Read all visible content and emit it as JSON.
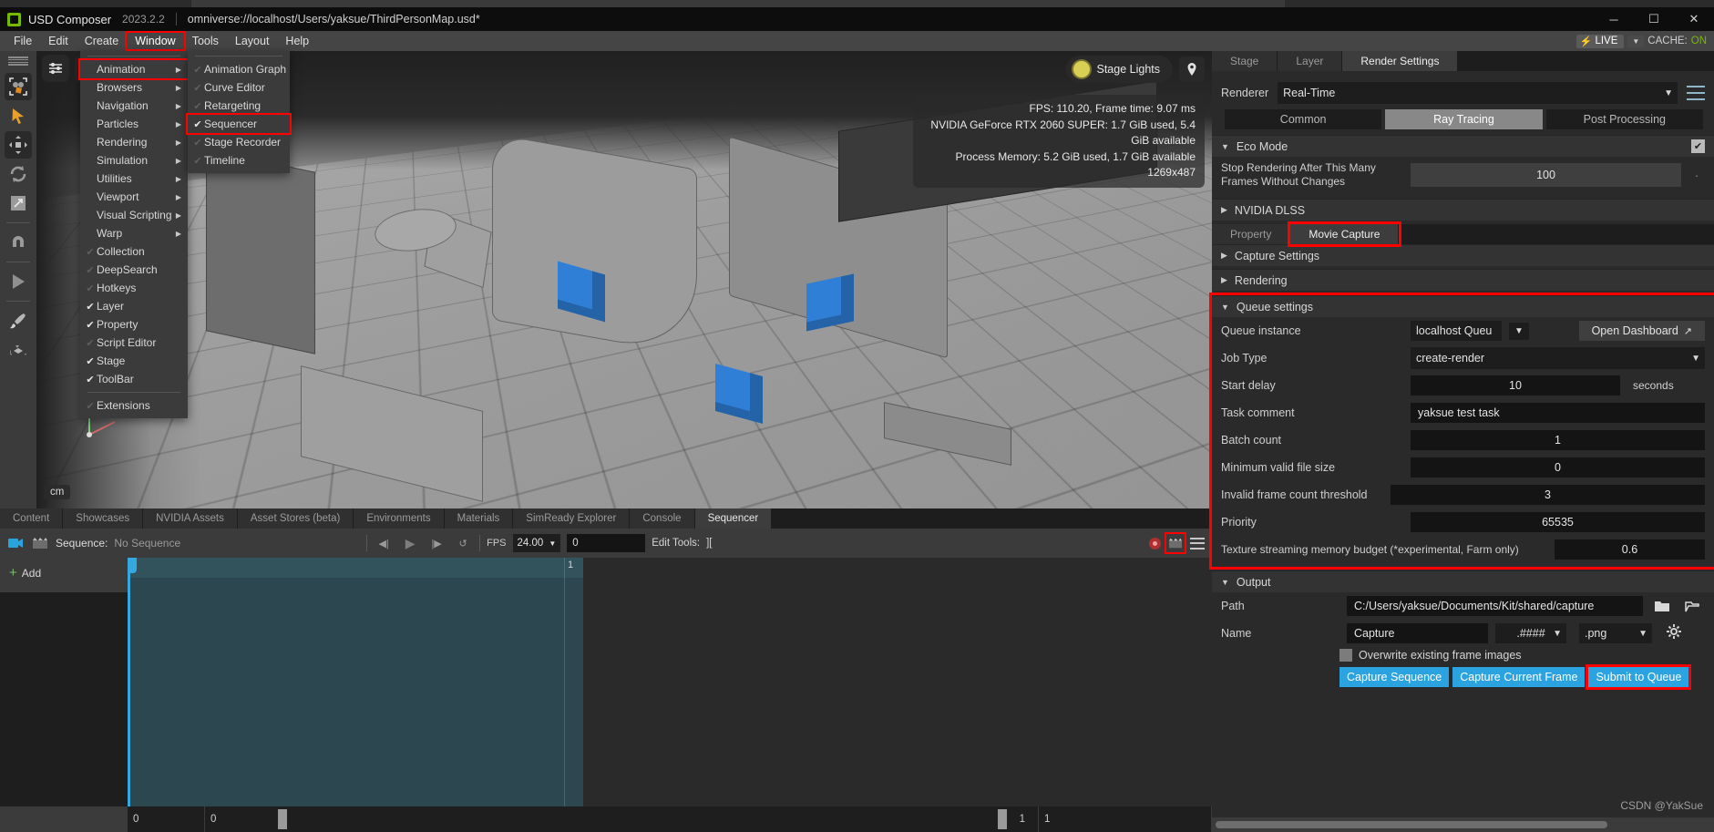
{
  "titlebar": {
    "app_name": "USD Composer",
    "version": "2023.2.2",
    "path": "omniverse://localhost/Users/yaksue/ThirdPersonMap.usd*",
    "minimize": "─",
    "maximize": "☐",
    "close": "✕"
  },
  "menubar": {
    "items": [
      "File",
      "Edit",
      "Create",
      "Window",
      "Tools",
      "Layout",
      "Help"
    ],
    "active": "Window",
    "live_label": "LIVE",
    "live_bolt": "⚡",
    "live_caret": "▼",
    "cache_label": "CACHE:",
    "cache_value": "ON"
  },
  "window_menu": {
    "items": [
      {
        "label": "Animation",
        "check": "none",
        "submenu": true,
        "highlight": true
      },
      {
        "label": "Browsers",
        "check": "none",
        "submenu": true,
        "highlight": false
      },
      {
        "label": "Navigation",
        "check": "none",
        "submenu": true,
        "highlight": false
      },
      {
        "label": "Particles",
        "check": "none",
        "submenu": true,
        "highlight": false
      },
      {
        "label": "Rendering",
        "check": "none",
        "submenu": true,
        "highlight": false
      },
      {
        "label": "Simulation",
        "check": "none",
        "submenu": true,
        "highlight": false
      },
      {
        "label": "Utilities",
        "check": "none",
        "submenu": true,
        "highlight": false
      },
      {
        "label": "Viewport",
        "check": "none",
        "submenu": true,
        "highlight": false
      },
      {
        "label": "Visual Scripting",
        "check": "none",
        "submenu": true,
        "highlight": false
      },
      {
        "label": "Warp",
        "check": "none",
        "submenu": true,
        "highlight": false
      },
      {
        "label": "Collection",
        "check": "off",
        "submenu": false,
        "highlight": false
      },
      {
        "label": "DeepSearch",
        "check": "off",
        "submenu": false,
        "highlight": false
      },
      {
        "label": "Hotkeys",
        "check": "off",
        "submenu": false,
        "highlight": false
      },
      {
        "label": "Layer",
        "check": "on",
        "submenu": false,
        "highlight": false
      },
      {
        "label": "Property",
        "check": "on",
        "submenu": false,
        "highlight": false
      },
      {
        "label": "Script Editor",
        "check": "off",
        "submenu": false,
        "highlight": false
      },
      {
        "label": "Stage",
        "check": "on",
        "submenu": false,
        "highlight": false
      },
      {
        "label": "ToolBar",
        "check": "on",
        "submenu": false,
        "highlight": false
      },
      {
        "label": "Extensions",
        "check": "off",
        "submenu": false,
        "highlight": false,
        "separator_before": true
      }
    ],
    "submenu_items": [
      {
        "label": "Animation Graph",
        "check": "off",
        "highlight": false
      },
      {
        "label": "Curve Editor",
        "check": "off",
        "highlight": false
      },
      {
        "label": "Retargeting",
        "check": "off",
        "highlight": false
      },
      {
        "label": "Sequencer",
        "check": "on",
        "highlight": true
      },
      {
        "label": "Stage Recorder",
        "check": "off",
        "highlight": false
      },
      {
        "label": "Timeline",
        "check": "off",
        "highlight": false
      }
    ],
    "check_on": "✔",
    "check_off": "✔",
    "arrow": "▶"
  },
  "viewport": {
    "stage_lights": "Stage Lights",
    "unit": "cm",
    "hud": [
      "FPS: 110.20, Frame time: 9.07 ms",
      "NVIDIA GeForce RTX 2060 SUPER: 1.7 GiB used, 5.4 GiB available",
      "Process Memory: 5.2 GiB used, 1.7 GiB available",
      "1269x487"
    ]
  },
  "dock": {
    "tabs": [
      "Content",
      "Showcases",
      "NVIDIA Assets",
      "Asset Stores (beta)",
      "Environments",
      "Materials",
      "SimReady Explorer",
      "Console",
      "Sequencer"
    ],
    "selected": "Sequencer"
  },
  "sequencer": {
    "sequence_label": "Sequence:",
    "sequence_value": "No Sequence",
    "fps_label": "FPS",
    "fps_value": "24.00",
    "fps_caret": "▼",
    "frame_value": "0",
    "edit_tools_label": "Edit Tools:",
    "edit_tools_value": "][",
    "add_label": "Add",
    "ruler_marks": [
      "1"
    ],
    "prev_icon": "◀|",
    "play_icon": "▶",
    "next_icon": "|▶",
    "loop_icon": "↺"
  },
  "scrollbar_row": {
    "left_value": "0",
    "mid_value": "0",
    "right_value": "1",
    "far_value": "1"
  },
  "right_panel": {
    "tabs": [
      "Stage",
      "Layer",
      "Render Settings"
    ],
    "selected_tab": "Render Settings",
    "renderer_label": "Renderer",
    "renderer_value": "Real-Time",
    "renderer_caret": "▼",
    "mode_tabs": [
      "Common",
      "Ray Tracing",
      "Post Processing"
    ],
    "mode_selected": "Ray Tracing",
    "eco_mode": {
      "title": "Eco Mode",
      "checked": true,
      "stop_label": "Stop Rendering After This Many Frames Without Changes",
      "stop_value": "100"
    },
    "dlss_title": "NVIDIA DLSS",
    "sub_tabs": [
      "Property",
      "Movie Capture"
    ],
    "sub_selected": "Movie Capture",
    "sections": [
      {
        "title": "Capture Settings",
        "expanded": false
      },
      {
        "title": "Rendering",
        "expanded": false
      }
    ],
    "queue_settings": {
      "title": "Queue settings",
      "queue_instance_label": "Queue instance",
      "queue_instance_value": "localhost Queu",
      "queue_caret": "▼",
      "open_dashboard_label": "Open Dashboard",
      "open_dashboard_icon": "↗",
      "job_type_label": "Job Type",
      "job_type_value": "create-render",
      "start_delay_label": "Start delay",
      "start_delay_value": "10",
      "start_delay_unit": "seconds",
      "task_comment_label": "Task comment",
      "task_comment_value": "yaksue test task",
      "batch_count_label": "Batch count",
      "batch_count_value": "1",
      "min_file_size_label": "Minimum valid file size",
      "min_file_size_value": "0",
      "invalid_frame_label": "Invalid frame count threshold",
      "invalid_frame_value": "3",
      "priority_label": "Priority",
      "priority_value": "65535",
      "texture_budget_label": "Texture streaming memory budget (*experimental, Farm only)",
      "texture_budget_value": "0.6"
    },
    "output": {
      "title": "Output",
      "path_label": "Path",
      "path_value": "C:/Users/yaksue/Documents/Kit/shared/capture",
      "name_label": "Name",
      "name_value": "Capture",
      "pattern_value": ".####",
      "pattern_caret": "▼",
      "ext_value": ".png",
      "ext_caret": "▼",
      "overwrite_label": "Overwrite existing frame images",
      "overwrite_checked": false,
      "buttons": [
        "Capture Sequence",
        "Capture Current Frame",
        "Submit to Queue"
      ],
      "highlighted_button": "Submit to Queue"
    },
    "watermark": "CSDN @YakSue"
  },
  "colors": {
    "accent_blue": "#2ba3e0",
    "highlight_red": "#ff0000",
    "nvidia_green": "#76b900",
    "timeline_teal": "#2d4750"
  }
}
